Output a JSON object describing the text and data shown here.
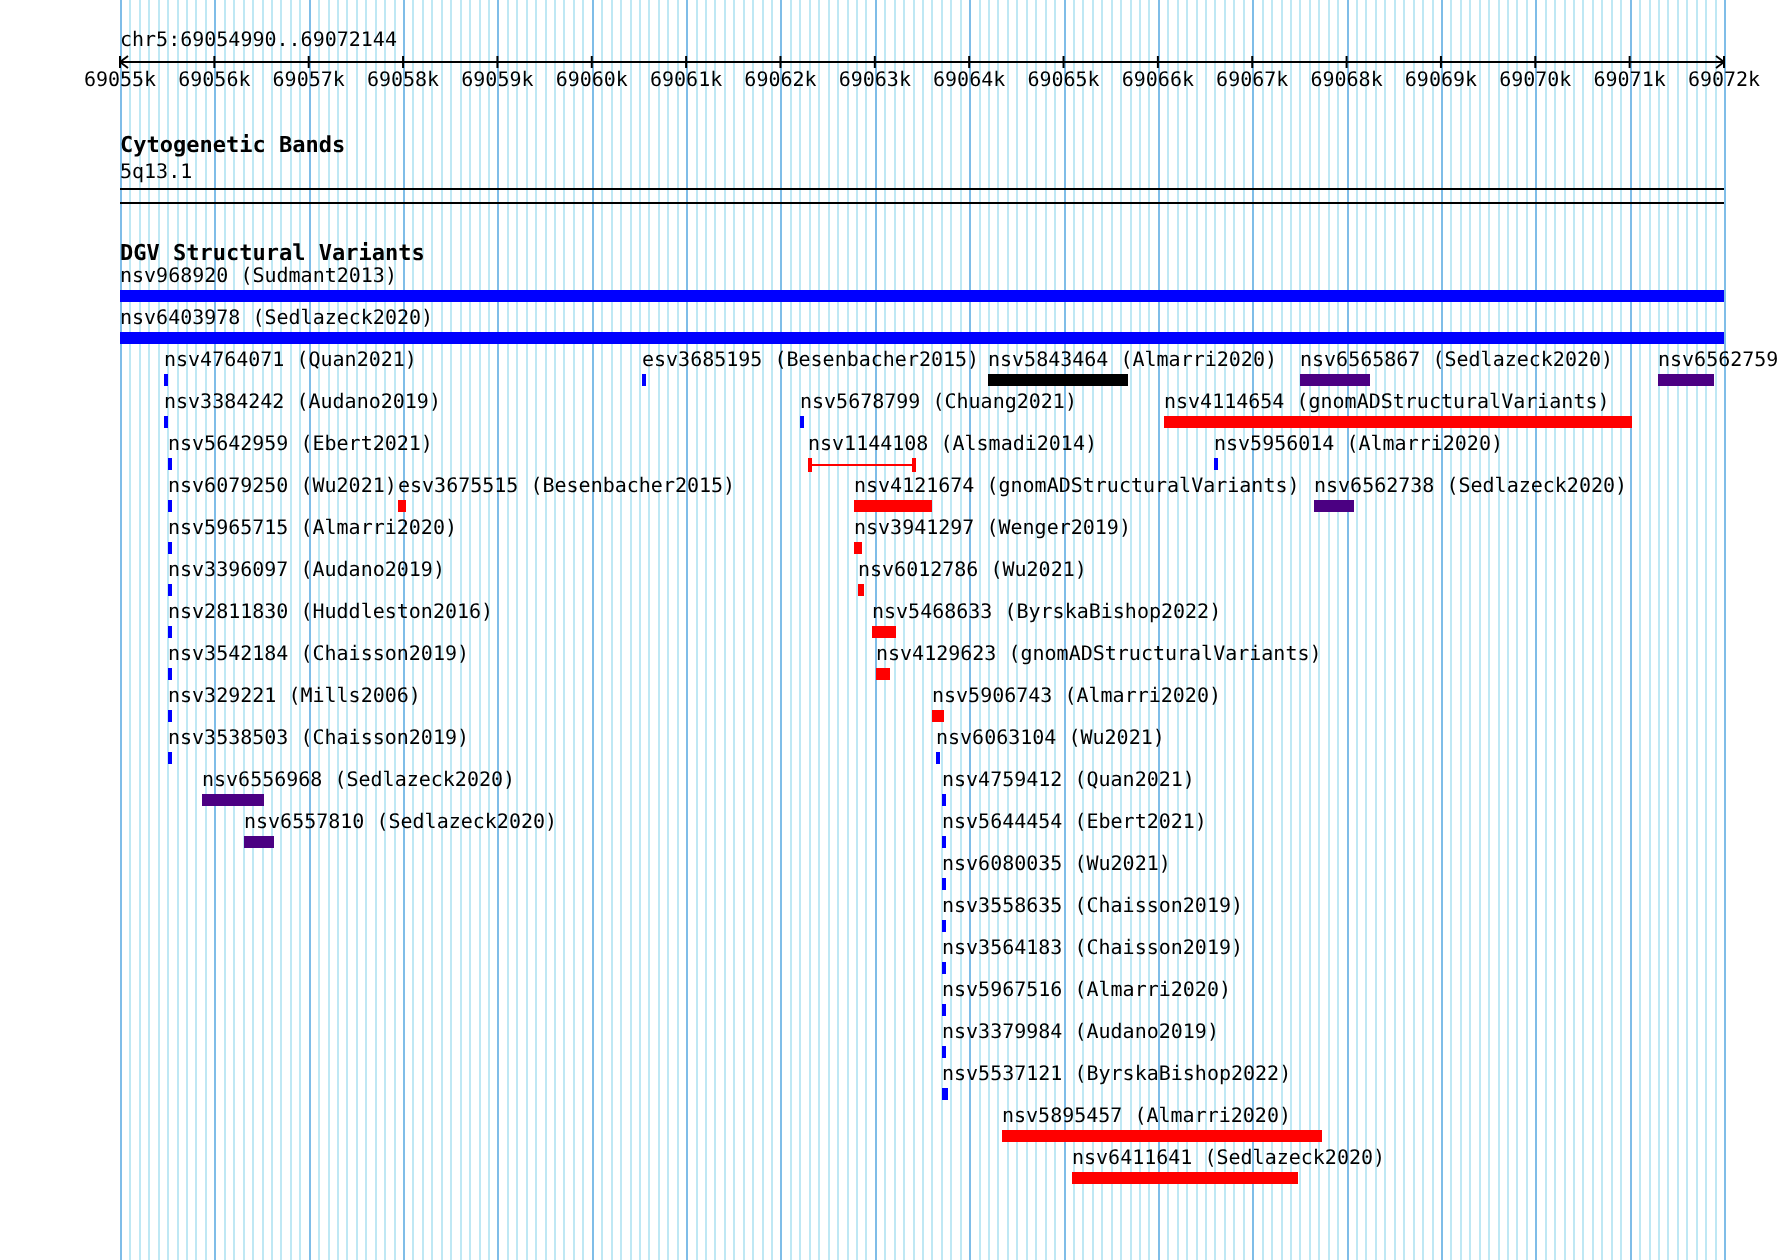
{
  "location": "chr5:69054990..69072144",
  "ruler": {
    "ticks": [
      "69055k",
      "69056k",
      "69057k",
      "69058k",
      "69059k",
      "69060k",
      "69061k",
      "69062k",
      "69063k",
      "69064k",
      "69065k",
      "69066k",
      "69067k",
      "69068k",
      "69069k",
      "69070k",
      "69071k",
      "69072k"
    ]
  },
  "cytogenetic_bands": {
    "title": "Cytogenetic Bands",
    "band": "5q13.1"
  },
  "dgv": {
    "title": "DGV Structural Variants",
    "features": [
      {
        "label": "nsv968920 (Sudmant2013)",
        "color": "#0000ff",
        "kind": "bar"
      },
      {
        "label": "nsv6403978 (Sedlazeck2020)",
        "color": "#0000ff",
        "kind": "bar"
      },
      {
        "label": "nsv4764071 (Quan2021)",
        "color": "#0000ff",
        "kind": "bar"
      },
      {
        "label": "esv3685195 (Besenbacher2015)",
        "color": "#0000ff",
        "kind": "bar"
      },
      {
        "label": "nsv5843464 (Almarri2020)",
        "color": "#000000",
        "kind": "bar"
      },
      {
        "label": "nsv6565867 (Sedlazeck2020)",
        "color": "#4b0082",
        "kind": "bar"
      },
      {
        "label": "nsv6562759",
        "color": "#4b0082",
        "kind": "bar"
      },
      {
        "label": "nsv3384242 (Audano2019)",
        "color": "#0000ff",
        "kind": "bar"
      },
      {
        "label": "nsv5678799 (Chuang2021)",
        "color": "#0000ff",
        "kind": "bar"
      },
      {
        "label": "nsv4114654 (gnomADStructuralVariants)",
        "color": "#ff0000",
        "kind": "bar"
      },
      {
        "label": "nsv5642959 (Ebert2021)",
        "color": "#0000ff",
        "kind": "bar"
      },
      {
        "label": "nsv1144108 (Alsmadi2014)",
        "color": "#ff0000",
        "kind": "interval"
      },
      {
        "label": "nsv5956014 (Almarri2020)",
        "color": "#0000ff",
        "kind": "bar"
      },
      {
        "label": "nsv6079250 (Wu2021)",
        "color": "#0000ff",
        "kind": "bar"
      },
      {
        "label": "esv3675515 (Besenbacher2015)",
        "color": "#ff0000",
        "kind": "bar"
      },
      {
        "label": "nsv4121674 (gnomADStructuralVariants)",
        "color": "#ff0000",
        "kind": "bar"
      },
      {
        "label": "nsv6562738 (Sedlazeck2020)",
        "color": "#4b0082",
        "kind": "bar"
      },
      {
        "label": "nsv5965715 (Almarri2020)",
        "color": "#0000ff",
        "kind": "bar"
      },
      {
        "label": "nsv3941297 (Wenger2019)",
        "color": "#ff0000",
        "kind": "bar"
      },
      {
        "label": "nsv3396097 (Audano2019)",
        "color": "#0000ff",
        "kind": "bar"
      },
      {
        "label": "nsv6012786 (Wu2021)",
        "color": "#ff0000",
        "kind": "bar"
      },
      {
        "label": "nsv2811830 (Huddleston2016)",
        "color": "#0000ff",
        "kind": "bar"
      },
      {
        "label": "nsv5468633 (ByrskaBishop2022)",
        "color": "#ff0000",
        "kind": "bar"
      },
      {
        "label": "nsv3542184 (Chaisson2019)",
        "color": "#0000ff",
        "kind": "bar"
      },
      {
        "label": "nsv4129623 (gnomADStructuralVariants)",
        "color": "#ff0000",
        "kind": "bar"
      },
      {
        "label": "nsv329221 (Mills2006)",
        "color": "#0000ff",
        "kind": "bar"
      },
      {
        "label": "nsv5906743 (Almarri2020)",
        "color": "#ff0000",
        "kind": "bar"
      },
      {
        "label": "nsv3538503 (Chaisson2019)",
        "color": "#0000ff",
        "kind": "bar"
      },
      {
        "label": "nsv6063104 (Wu2021)",
        "color": "#0000ff",
        "kind": "bar"
      },
      {
        "label": "nsv6556968 (Sedlazeck2020)",
        "color": "#4b0082",
        "kind": "bar"
      },
      {
        "label": "nsv4759412 (Quan2021)",
        "color": "#0000ff",
        "kind": "bar"
      },
      {
        "label": "nsv6557810 (Sedlazeck2020)",
        "color": "#4b0082",
        "kind": "bar"
      },
      {
        "label": "nsv5644454 (Ebert2021)",
        "color": "#0000ff",
        "kind": "bar"
      },
      {
        "label": "nsv6080035 (Wu2021)",
        "color": "#0000ff",
        "kind": "bar"
      },
      {
        "label": "nsv3558635 (Chaisson2019)",
        "color": "#0000ff",
        "kind": "bar"
      },
      {
        "label": "nsv3564183 (Chaisson2019)",
        "color": "#0000ff",
        "kind": "bar"
      },
      {
        "label": "nsv5967516 (Almarri2020)",
        "color": "#0000ff",
        "kind": "bar"
      },
      {
        "label": "nsv3379984 (Audano2019)",
        "color": "#0000ff",
        "kind": "bar"
      },
      {
        "label": "nsv5537121 (ByrskaBishop2022)",
        "color": "#0000ff",
        "kind": "bar"
      },
      {
        "label": "nsv5895457 (Almarri2020)",
        "color": "#ff0000",
        "kind": "bar"
      },
      {
        "label": "nsv6411641 (Sedlazeck2020)",
        "color": "#ff0000",
        "kind": "bar"
      }
    ]
  }
}
